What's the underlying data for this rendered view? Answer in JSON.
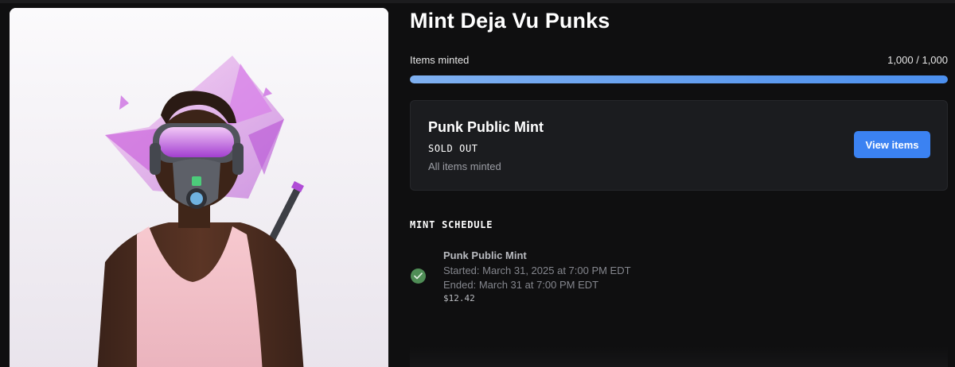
{
  "collection": {
    "title": "Mint Deja Vu Punks"
  },
  "progress": {
    "label": "Items minted",
    "count_text": "1,000 / 1,000",
    "minted": 1000,
    "total": 1000,
    "fill_fraction": 1.0,
    "fill_color": "#4b8fee"
  },
  "mint_stage": {
    "name": "Punk Public Mint",
    "status": "SOLD OUT",
    "subtext": "All items minted",
    "button_label": "View items",
    "button_color": "#3b82f2"
  },
  "schedule": {
    "heading": "MINT SCHEDULE",
    "items": [
      {
        "name": "Punk Public Mint",
        "started": "Started: March 31, 2025 at 7:00 PM EDT",
        "ended": "Ended: March 31 at 7:00 PM EDT",
        "price": "$12.42",
        "status_icon": "check-circle-icon",
        "status_color": "#4f8d56"
      }
    ]
  },
  "artwork": {
    "subject": "masked-punk-character-icon"
  }
}
